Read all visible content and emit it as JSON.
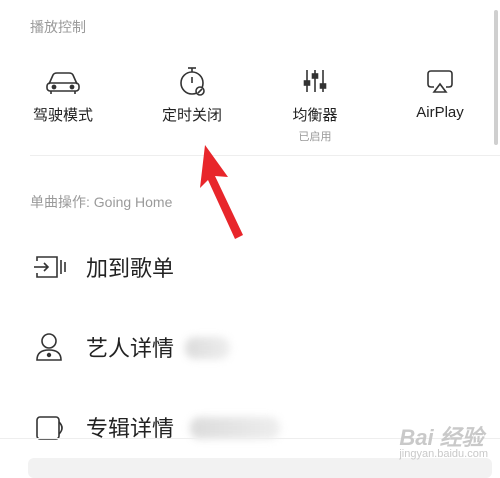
{
  "playback": {
    "section_title": "播放控制",
    "items": [
      {
        "label": "驾驶模式",
        "sub": "",
        "icon": "car-icon"
      },
      {
        "label": "定时关闭",
        "sub": "",
        "icon": "timer-icon"
      },
      {
        "label": "均衡器",
        "sub": "已启用",
        "icon": "equalizer-icon"
      },
      {
        "label": "AirPlay",
        "sub": "",
        "icon": "airplay-icon"
      }
    ]
  },
  "song_actions": {
    "section_title": "单曲操作: Going Home",
    "items": [
      {
        "label": "加到歌单",
        "icon": "add-to-playlist-icon"
      },
      {
        "label": "艺人详情",
        "icon": "artist-icon"
      },
      {
        "label": "专辑详情",
        "icon": "album-icon"
      }
    ]
  },
  "annotation": {
    "color": "#e8262b",
    "icon": "red-arrow-icon"
  },
  "watermark": {
    "brand": "Bai 经验",
    "sub": "jingyan.baidu.com"
  }
}
